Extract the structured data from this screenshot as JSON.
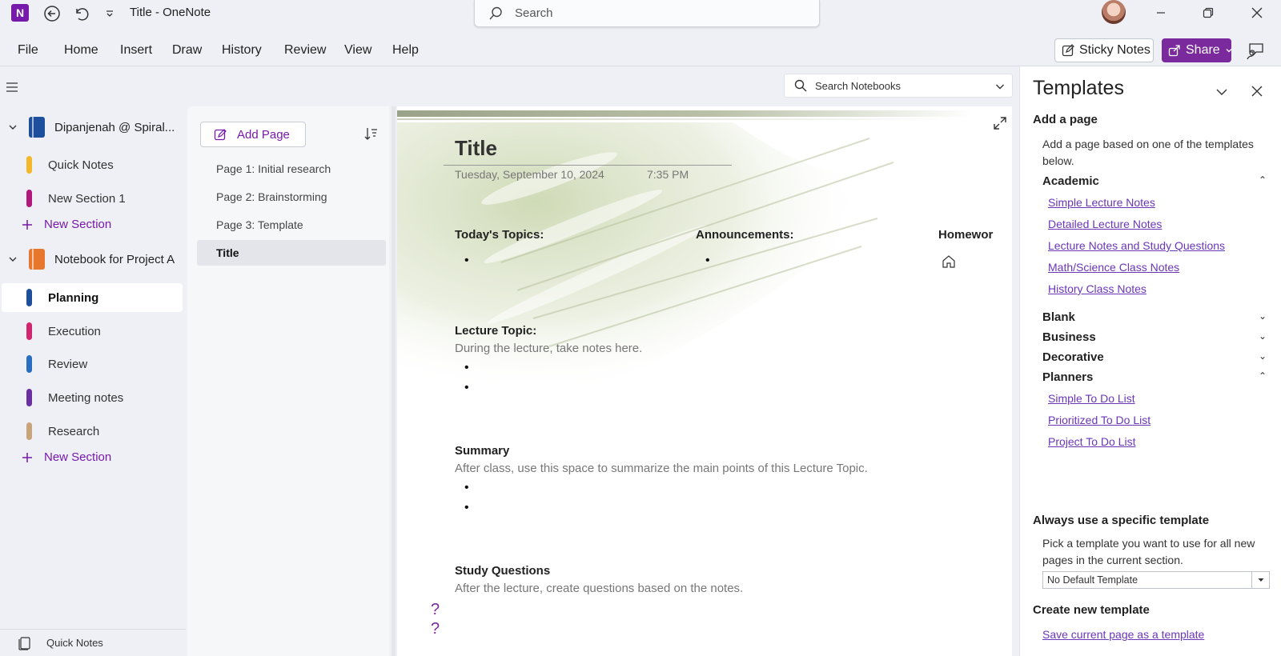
{
  "window": {
    "app_icon_letter": "N",
    "title": "Title  -  OneNote",
    "search_placeholder": "Search"
  },
  "menu": {
    "items": [
      "File",
      "Home",
      "Insert",
      "Draw",
      "History",
      "Review",
      "View",
      "Help"
    ],
    "sticky_notes": "Sticky Notes",
    "share": "Share"
  },
  "notebooks": [
    {
      "name": "Dipanjenah @ Spiral...",
      "color": "#1e4f9c",
      "sections": [
        {
          "label": "Quick Notes",
          "color": "#f3b72a"
        },
        {
          "label": "New Section 1",
          "color": "#b0187a"
        }
      ],
      "new_section": "New Section"
    },
    {
      "name": "Notebook for Project A",
      "color": "#e8772e",
      "sections": [
        {
          "label": "Planning",
          "color": "#1e4f9c",
          "active": true
        },
        {
          "label": "Execution",
          "color": "#d1256f"
        },
        {
          "label": "Review",
          "color": "#2a6fbf"
        },
        {
          "label": "Meeting notes",
          "color": "#6b2fa0"
        },
        {
          "label": "Research",
          "color": "#c9a37a"
        }
      ],
      "new_section": "New Section"
    }
  ],
  "footer_quick_notes": "Quick Notes",
  "pages": {
    "add_page": "Add Page",
    "list": [
      "Page 1: Initial research",
      "Page 2: Brainstorming",
      "Page 3: Template",
      "Title"
    ],
    "active_index": 3
  },
  "search_notebooks": "Search Notebooks",
  "canvas": {
    "title": "Title",
    "date": "Tuesday, September 10, 2024",
    "time": "7:35 PM",
    "todays_topics": "Today's Topics:",
    "announcements": "Announcements:",
    "homework": "Homewor",
    "lecture_topic": "Lecture Topic:",
    "lecture_sub": "During the lecture, take notes here.",
    "summary": "Summary",
    "summary_sub": "After class, use this space to summarize the main points of this Lecture Topic.",
    "study_questions": "Study Questions",
    "study_sub": "After the lecture, create questions based on the notes.",
    "bullet": "•",
    "question_mark": "?"
  },
  "templates": {
    "title": "Templates",
    "add_a_page": "Add a page",
    "add_desc": "Add a page based on one of the templates below.",
    "categories": {
      "academic": "Academic",
      "blank": "Blank",
      "business": "Business",
      "decorative": "Decorative",
      "planners": "Planners"
    },
    "academic_links": [
      "Simple Lecture Notes",
      "Detailed Lecture Notes",
      "Lecture Notes and Study Questions",
      "Math/Science Class Notes",
      "History Class Notes"
    ],
    "planner_links": [
      "Simple To Do List",
      "Prioritized To Do List",
      "Project To Do List"
    ],
    "always_use": "Always use a specific template",
    "always_desc": "Pick a template you want to use for all new pages in the current section.",
    "default_select": "No Default Template",
    "create_new": "Create new template",
    "save_link": "Save current page as a template"
  },
  "colors": {
    "accent": "#7719aa",
    "share_bg": "#7b2a9e",
    "link": "#6a36b8"
  },
  "icons": [
    "onenote-icon",
    "back-icon",
    "undo-icon",
    "customize-icon",
    "search-icon",
    "minimize-icon",
    "restore-icon",
    "close-icon",
    "sticky-notes-icon",
    "share-icon",
    "feedback-icon",
    "hamburger-icon",
    "add-page-icon",
    "sort-icon",
    "expand-icon",
    "home-icon",
    "plus-icon"
  ]
}
